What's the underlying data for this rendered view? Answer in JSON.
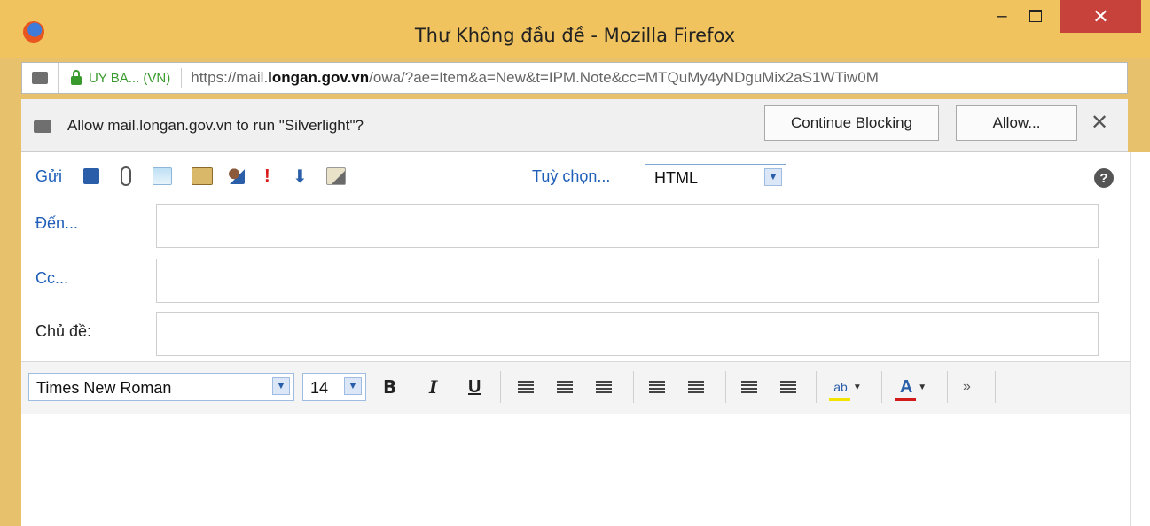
{
  "window": {
    "title": "Thư Không đầu đề - Mozilla Firefox",
    "min_glyph": "–",
    "close_glyph": "✕"
  },
  "urlbar": {
    "identity": "UY BA... (VN)",
    "url_prefix": "https://mail.",
    "url_domain": "longan.gov.vn",
    "url_path": "/owa/?ae=Item&a=New&t=IPM.Note&cc=MTQuMy4yNDguMix2aS1WTiw0M"
  },
  "notification": {
    "text": "Allow mail.longan.gov.vn to run \"Silverlight\"?",
    "continue_blocking": "Continue Blocking",
    "allow": "Allow...",
    "close": "✕"
  },
  "toolbar": {
    "send": "Gửi",
    "options": "Tuỳ chọn...",
    "format_value": "HTML",
    "help": "?"
  },
  "fields": {
    "to_label": "Đến...",
    "cc_label": "Cc...",
    "subject_label": "Chủ đề:"
  },
  "editor": {
    "font": "Times New Roman",
    "size": "14",
    "bold": "B",
    "italic": "I",
    "underline": "U",
    "font_color_glyph": "A",
    "highlight_glyph": "ab",
    "more": "»",
    "highlight_color": "#f2e400",
    "font_color": "#d11a1a"
  },
  "colors": {
    "accent": "#1f5fb8",
    "titlebar": "#f0c35e",
    "close": "#c7423a"
  }
}
